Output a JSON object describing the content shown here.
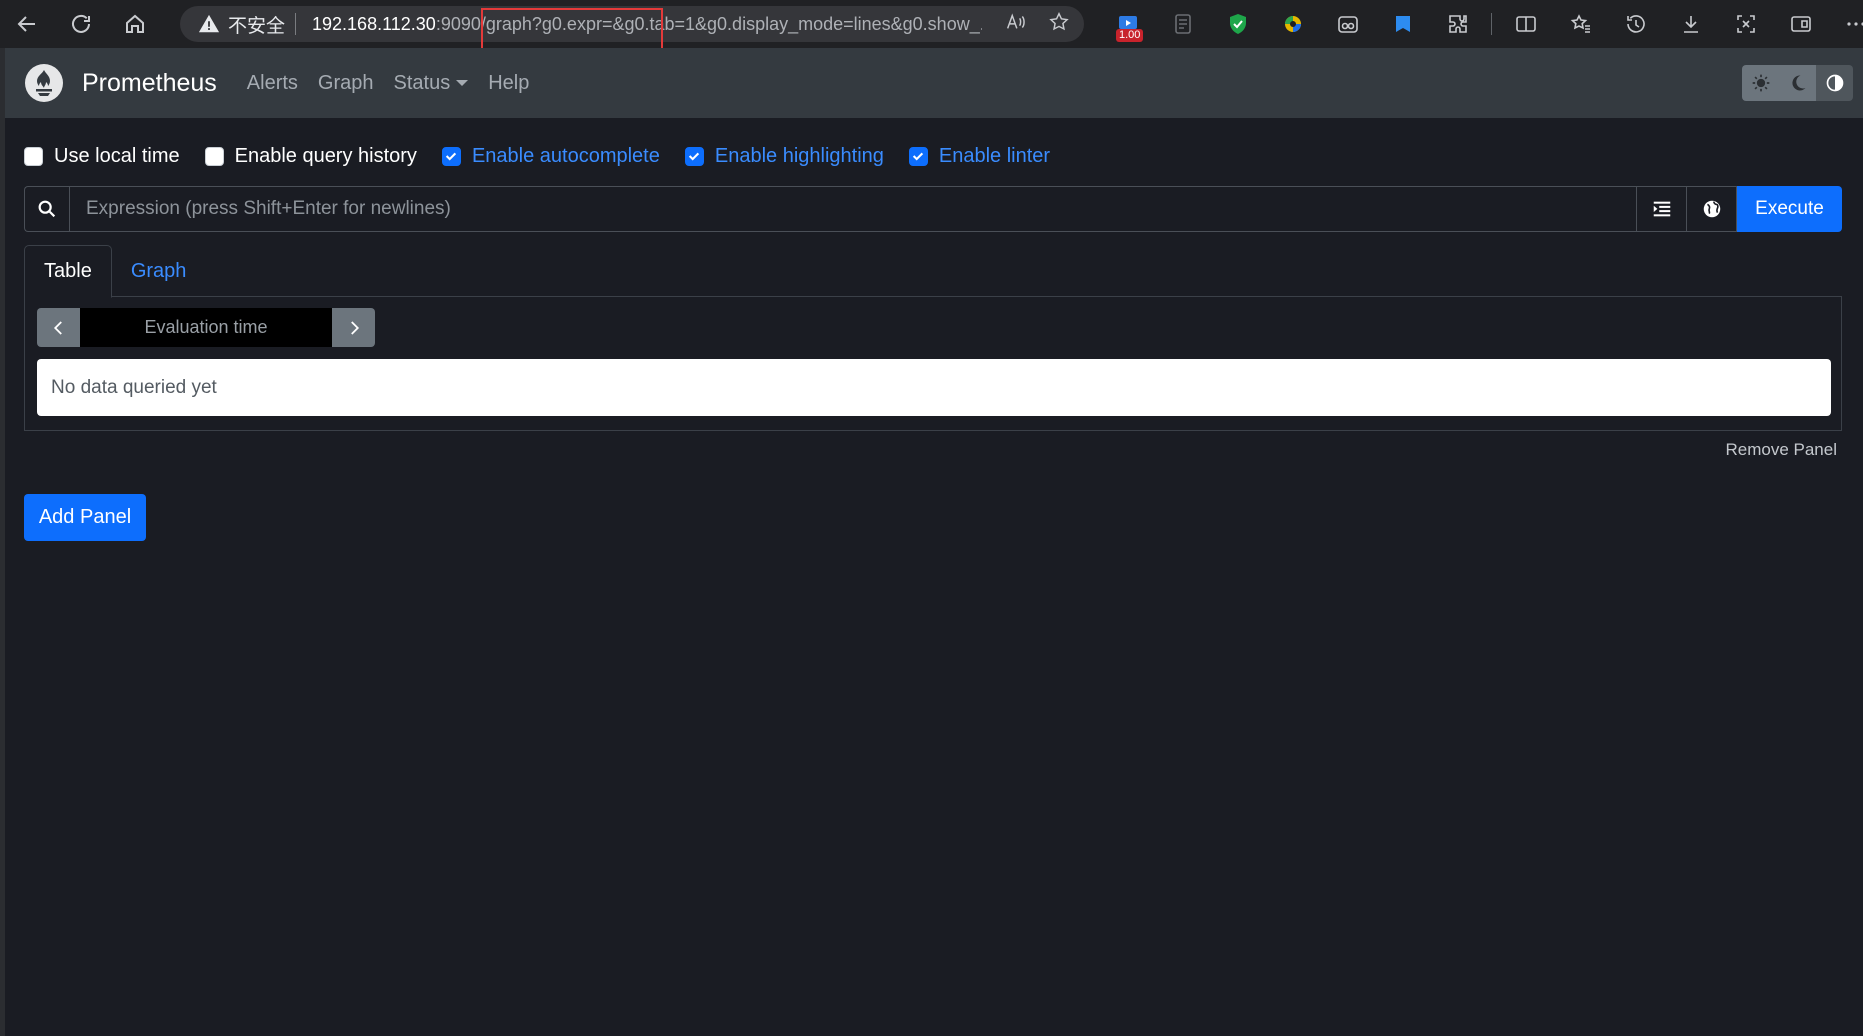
{
  "browser": {
    "insecure_label": "不安全",
    "url_host": "192.168.112.30",
    "url_port": ":9090",
    "url_path": "/graph?g0.expr=&g0.tab=1&g0.display_mode=lines&g0.show_...",
    "extension_badge": "1.00"
  },
  "navbar": {
    "brand": "Prometheus",
    "links": [
      "Alerts",
      "Graph",
      "Status",
      "Help"
    ]
  },
  "options": [
    {
      "label": "Use local time",
      "checked": false
    },
    {
      "label": "Enable query history",
      "checked": false
    },
    {
      "label": "Enable autocomplete",
      "checked": true
    },
    {
      "label": "Enable highlighting",
      "checked": true
    },
    {
      "label": "Enable linter",
      "checked": true
    }
  ],
  "expression": {
    "placeholder": "Expression (press Shift+Enter for newlines)",
    "execute_label": "Execute"
  },
  "tabs": [
    {
      "label": "Table",
      "active": true
    },
    {
      "label": "Graph",
      "active": false
    }
  ],
  "table_panel": {
    "evaluation_placeholder": "Evaluation time",
    "empty_message": "No data queried yet"
  },
  "panel_actions": {
    "remove_label": "Remove Panel",
    "add_label": "Add Panel"
  },
  "colors": {
    "accent": "#0d6efd",
    "navbar_bg": "#343a40",
    "page_bg": "#1a1c23",
    "highlight_box": "#e33a3a"
  }
}
